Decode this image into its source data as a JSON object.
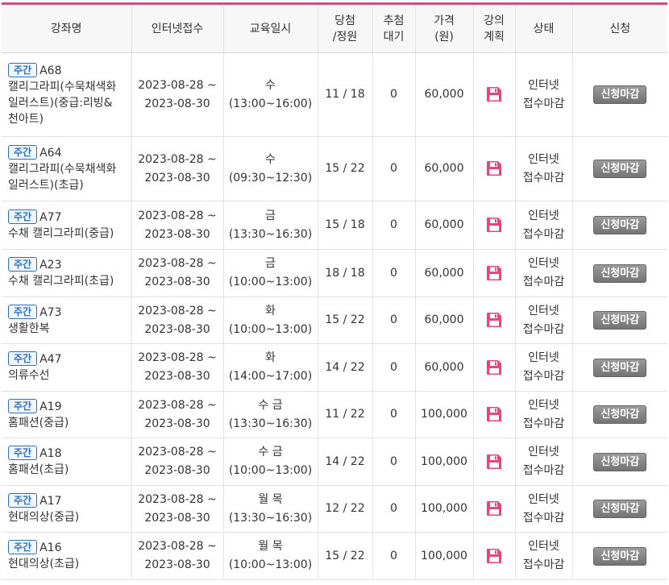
{
  "table": {
    "headers": {
      "name": "강좌명",
      "reg": "인터넷접수",
      "schedule": "교육일시",
      "quota_line1": "당첨",
      "quota_line2": "/정원",
      "wait_line1": "추첨",
      "wait_line2": "대기",
      "price_line1": "가격",
      "price_line2": "(원)",
      "plan_line1": "강의",
      "plan_line2": "계획",
      "status": "상태",
      "apply": "신청"
    },
    "rows": [
      {
        "badge": "주간",
        "code": "A68",
        "name_lines": [
          "캘리그라피(수묵채색화",
          "일러스트)(중급:리빙&",
          "천아트)"
        ],
        "reg_start": "2023-08-28 ~",
        "reg_end": "2023-08-30",
        "day": "수",
        "time": "(13:00~16:00)",
        "quota": "11 / 18",
        "wait": "0",
        "price": "60,000",
        "status_line1": "인터넷",
        "status_line2": "접수마감",
        "button": "신청마감"
      },
      {
        "badge": "주간",
        "code": "A64",
        "name_lines": [
          "캘리그라피(수묵채색화",
          "일러스트)(초급)"
        ],
        "reg_start": "2023-08-28 ~",
        "reg_end": "2023-08-30",
        "day": "수",
        "time": "(09:30~12:30)",
        "quota": "15 / 22",
        "wait": "0",
        "price": "60,000",
        "status_line1": "인터넷",
        "status_line2": "접수마감",
        "button": "신청마감"
      },
      {
        "badge": "주간",
        "code": "A77",
        "name_lines": [
          "수채 캘리그라피(중급)"
        ],
        "reg_start": "2023-08-28 ~",
        "reg_end": "2023-08-30",
        "day": "금",
        "time": "(13:30~16:30)",
        "quota": "15 / 18",
        "wait": "0",
        "price": "60,000",
        "status_line1": "인터넷",
        "status_line2": "접수마감",
        "button": "신청마감"
      },
      {
        "badge": "주간",
        "code": "A23",
        "name_lines": [
          "수채 캘리그라피(초급)"
        ],
        "reg_start": "2023-08-28 ~",
        "reg_end": "2023-08-30",
        "day": "금",
        "time": "(10:00~13:00)",
        "quota": "18 / 18",
        "wait": "0",
        "price": "60,000",
        "status_line1": "인터넷",
        "status_line2": "접수마감",
        "button": "신청마감"
      },
      {
        "badge": "주간",
        "code": "A73",
        "name_lines": [
          "생활한복"
        ],
        "reg_start": "2023-08-28 ~",
        "reg_end": "2023-08-30",
        "day": "화",
        "time": "(10:00~13:00)",
        "quota": "15 / 22",
        "wait": "0",
        "price": "60,000",
        "status_line1": "인터넷",
        "status_line2": "접수마감",
        "button": "신청마감"
      },
      {
        "badge": "주간",
        "code": "A47",
        "name_lines": [
          "의류수선"
        ],
        "reg_start": "2023-08-28 ~",
        "reg_end": "2023-08-30",
        "day": "화",
        "time": "(14:00~17:00)",
        "quota": "14 / 22",
        "wait": "0",
        "price": "60,000",
        "status_line1": "인터넷",
        "status_line2": "접수마감",
        "button": "신청마감"
      },
      {
        "badge": "주간",
        "code": "A19",
        "name_lines": [
          "홈패션(중급)"
        ],
        "reg_start": "2023-08-28 ~",
        "reg_end": "2023-08-30",
        "day": "수 금",
        "time": "(13:30~16:30)",
        "quota": "11 / 22",
        "wait": "0",
        "price": "100,000",
        "status_line1": "인터넷",
        "status_line2": "접수마감",
        "button": "신청마감"
      },
      {
        "badge": "주간",
        "code": "A18",
        "name_lines": [
          "홈패션(초급)"
        ],
        "reg_start": "2023-08-28 ~",
        "reg_end": "2023-08-30",
        "day": "수 금",
        "time": "(10:00~13:00)",
        "quota": "14 / 22",
        "wait": "0",
        "price": "100,000",
        "status_line1": "인터넷",
        "status_line2": "접수마감",
        "button": "신청마감"
      },
      {
        "badge": "주간",
        "code": "A17",
        "name_lines": [
          "현대의상(중급)"
        ],
        "reg_start": "2023-08-28 ~",
        "reg_end": "2023-08-30",
        "day": "월 목",
        "time": "(13:30~16:30)",
        "quota": "12 / 22",
        "wait": "0",
        "price": "100,000",
        "status_line1": "인터넷",
        "status_line2": "접수마감",
        "button": "신청마감"
      },
      {
        "badge": "주간",
        "code": "A16",
        "name_lines": [
          "현대의상(초급)"
        ],
        "reg_start": "2023-08-28 ~",
        "reg_end": "2023-08-30",
        "day": "월 목",
        "time": "(10:00~13:00)",
        "quota": "15 / 22",
        "wait": "0",
        "price": "100,000",
        "status_line1": "인터넷",
        "status_line2": "접수마감",
        "button": "신청마감"
      }
    ]
  },
  "colors": {
    "accent_top_border": "#d44a88",
    "badge_blue": "#2a6fc4",
    "plan_icon_pink": "#e8457f",
    "closed_button_gray": "#7f7f7f"
  },
  "icons": {
    "plan": "floppy-disk-icon"
  }
}
